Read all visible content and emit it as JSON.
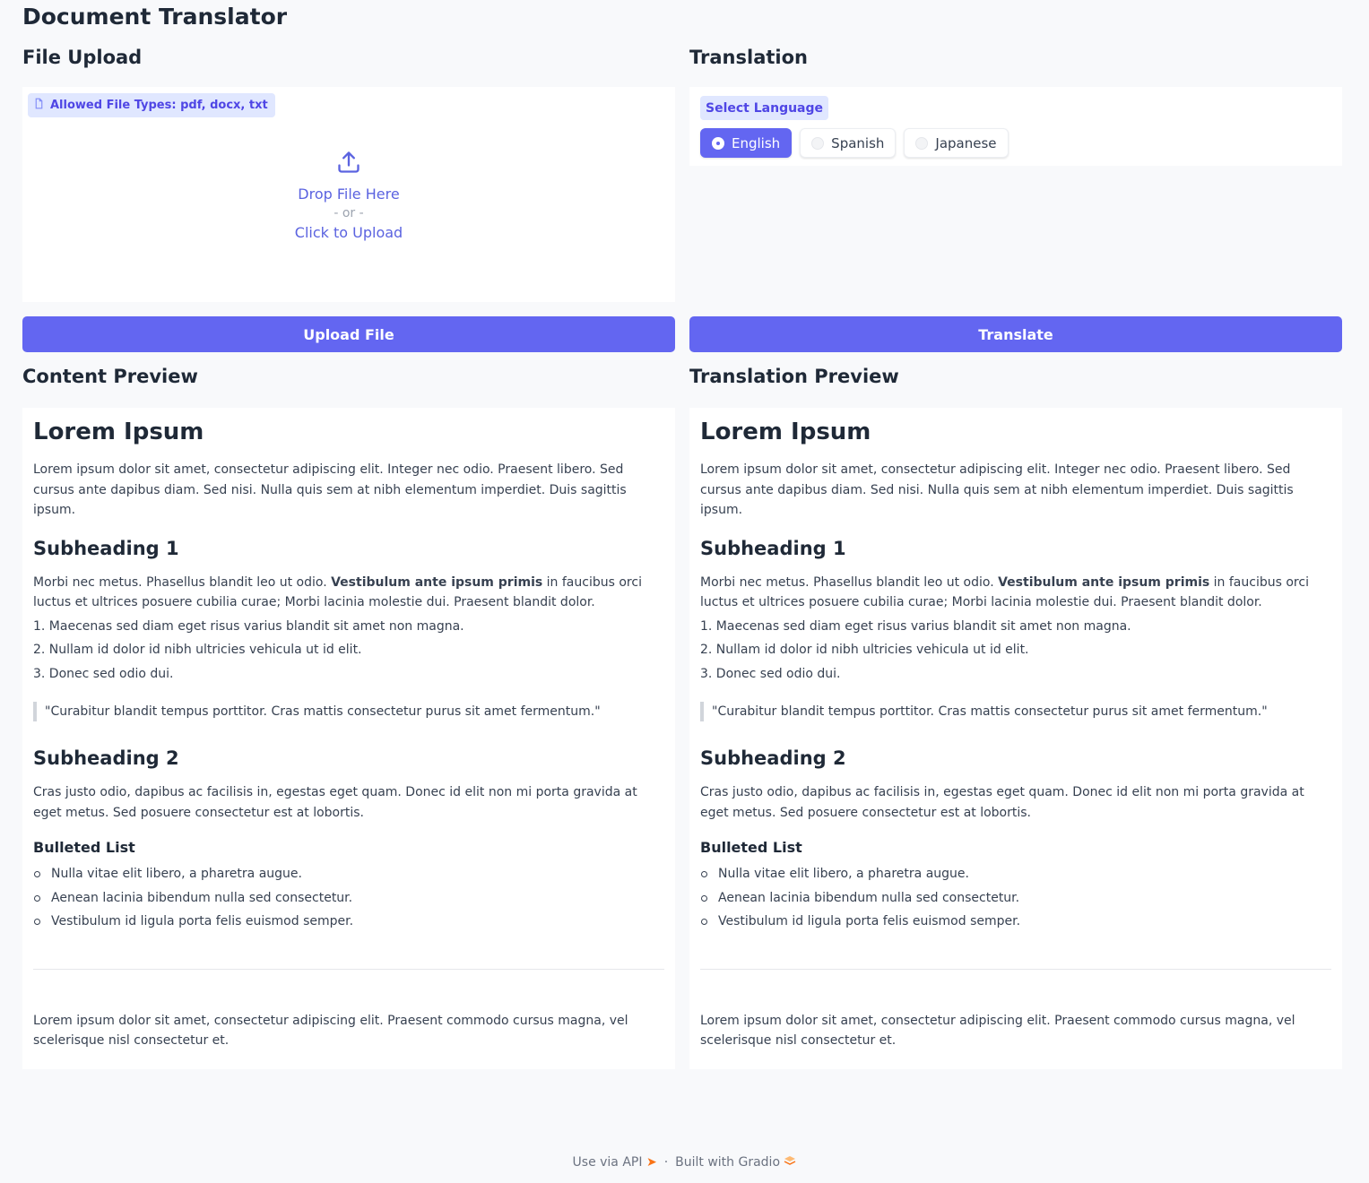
{
  "app": {
    "title": "Document Translator"
  },
  "upload": {
    "section_title": "File Upload",
    "allowed_types": "Allowed File Types: pdf, docx, txt",
    "drop_text": "Drop File Here",
    "or_text": "- or -",
    "click_text": "Click to Upload",
    "button_label": "Upload File"
  },
  "translation": {
    "section_title": "Translation",
    "select_label": "Select Language",
    "options": [
      "English",
      "Spanish",
      "Japanese"
    ],
    "selected": "English",
    "button_label": "Translate"
  },
  "content_preview": {
    "section_title": "Content Preview",
    "h1": "Lorem Ipsum",
    "intro": "Lorem ipsum dolor sit amet, consectetur adipiscing elit. Integer nec odio. Praesent libero. Sed cursus ante dapibus diam. Sed nisi. Nulla quis sem at nibh elementum imperdiet. Duis sagittis ipsum.",
    "sub1": "Subheading 1",
    "para2_before": "Morbi nec metus. Phasellus blandit leo ut odio. ",
    "para2_bold": "Vestibulum ante ipsum primis",
    "para2_after": " in faucibus orci luctus et ultrices posuere cubilia curae; Morbi lacinia molestie dui. Praesent blandit dolor.",
    "ordered": [
      "1. Maecenas sed diam eget risus varius blandit sit amet non magna.",
      "2. Nullam id dolor id nibh ultricies vehicula ut id elit.",
      "3. Donec sed odio dui."
    ],
    "quote": "\"Curabitur blandit tempus porttitor. Cras mattis consectetur purus sit amet fermentum.\"",
    "sub2": "Subheading 2",
    "para3": "Cras justo odio, dapibus ac facilisis in, egestas eget quam. Donec id elit non mi porta gravida at eget metus. Sed posuere consectetur est at lobortis.",
    "bullet_title": "Bulleted List",
    "bullets": [
      "Nulla vitae elit libero, a pharetra augue.",
      "Aenean lacinia bibendum nulla sed consectetur.",
      "Vestibulum id ligula porta felis euismod semper."
    ],
    "closing": "Lorem ipsum dolor sit amet, consectetur adipiscing elit. Praesent commodo cursus magna, vel scelerisque nisl consectetur et."
  },
  "translation_preview": {
    "section_title": "Translation Preview",
    "h1": "Lorem Ipsum",
    "intro": "Lorem ipsum dolor sit amet, consectetur adipiscing elit. Integer nec odio. Praesent libero. Sed cursus ante dapibus diam. Sed nisi. Nulla quis sem at nibh elementum imperdiet. Duis sagittis ipsum.",
    "sub1": "Subheading 1",
    "para2_before": "Morbi nec metus. Phasellus blandit leo ut odio. ",
    "para2_bold": "Vestibulum ante ipsum primis",
    "para2_after": " in faucibus orci luctus et ultrices posuere cubilia curae; Morbi lacinia molestie dui. Praesent blandit dolor.",
    "ordered": [
      "1. Maecenas sed diam eget risus varius blandit sit amet non magna.",
      "2. Nullam id dolor id nibh ultricies vehicula ut id elit.",
      "3. Donec sed odio dui."
    ],
    "quote": "\"Curabitur blandit tempus porttitor. Cras mattis consectetur purus sit amet fermentum.\"",
    "sub2": "Subheading 2",
    "para3": "Cras justo odio, dapibus ac facilisis in, egestas eget quam. Donec id elit non mi porta gravida at eget metus. Sed posuere consectetur est at lobortis.",
    "bullet_title": "Bulleted List",
    "bullets": [
      "Nulla vitae elit libero, a pharetra augue.",
      "Aenean lacinia bibendum nulla sed consectetur.",
      "Vestibulum id ligula porta felis euismod semper."
    ],
    "closing": "Lorem ipsum dolor sit amet, consectetur adipiscing elit. Praesent commodo cursus magna, vel scelerisque nisl consectetur et."
  },
  "footer": {
    "api_text": "Use via API",
    "separator": "·",
    "built_text": "Built with Gradio",
    "icons": [
      "rocket-icon",
      "gradio-logo-icon"
    ]
  },
  "colors": {
    "accent": "#6366f1",
    "badge_bg": "#e0e7ff",
    "badge_text": "#4f46e5",
    "page_bg": "#f8f9fb",
    "panel_bg": "#ffffff"
  }
}
